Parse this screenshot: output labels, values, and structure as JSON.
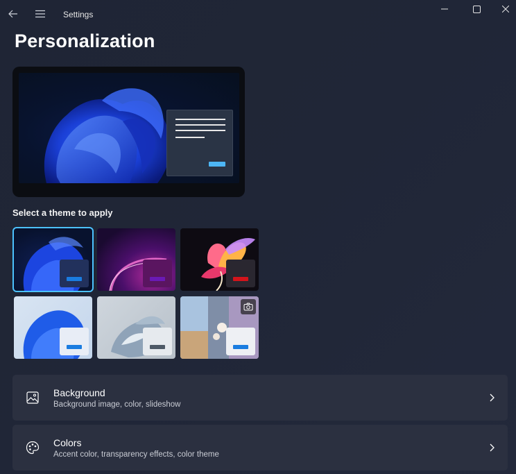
{
  "window": {
    "app_title": "Settings",
    "controls": [
      "minimize-icon",
      "maximize-icon",
      "close-icon"
    ]
  },
  "page": {
    "title": "Personalization"
  },
  "themes": {
    "label": "Select a theme to apply",
    "items": [
      {
        "name": "dark-bloom",
        "selected": true,
        "card_color": "#22315c",
        "accent_color": "#1a7ce0"
      },
      {
        "name": "glow",
        "selected": false,
        "card_color": "#5a1560",
        "accent_color": "#6a1ab5"
      },
      {
        "name": "captured-motion",
        "selected": false,
        "card_color": "#2a2730",
        "accent_color": "#d3141b"
      },
      {
        "name": "light-bloom",
        "selected": false,
        "card_color": "#e8edf6",
        "accent_color": "#1a7ce0"
      },
      {
        "name": "sunrise",
        "selected": false,
        "card_color": "#e6eaee",
        "accent_color": "#4d5966"
      },
      {
        "name": "spotlight-collection",
        "selected": false,
        "card_color": "#eef0f4",
        "accent_color": "#1a7ce0",
        "badge": "camera-icon"
      }
    ]
  },
  "settings": {
    "background": {
      "title": "Background",
      "subtitle": "Background image, color, slideshow",
      "icon": "image-icon"
    },
    "colors": {
      "title": "Colors",
      "subtitle": "Accent color, transparency effects, color theme",
      "icon": "palette-icon"
    }
  },
  "colors": {
    "accent": "#4cc2ff",
    "row_background": "#2b3040",
    "page_background": "#202637"
  }
}
